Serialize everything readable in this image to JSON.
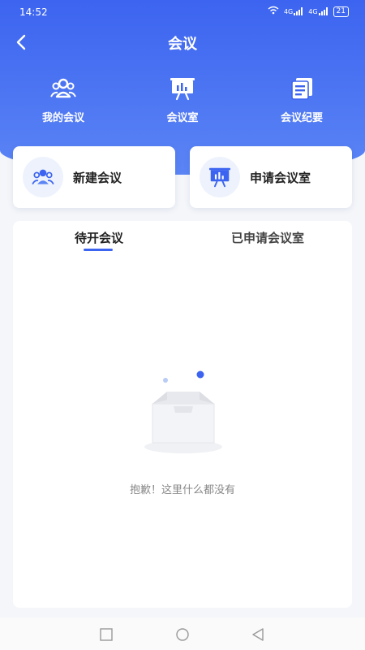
{
  "status": {
    "time": "14:52",
    "signal1": "4G",
    "signal2": "4G",
    "battery": "21"
  },
  "header": {
    "title": "会议"
  },
  "quick_nav": [
    {
      "label": "我的会议",
      "icon": "group-icon"
    },
    {
      "label": "会议室",
      "icon": "presentation-board-icon"
    },
    {
      "label": "会议纪要",
      "icon": "notes-icon"
    }
  ],
  "actions": [
    {
      "label": "新建会议",
      "icon": "group-icon"
    },
    {
      "label": "申请会议室",
      "icon": "presentation-board-icon"
    }
  ],
  "tabs": [
    {
      "label": "待开会议",
      "active": true
    },
    {
      "label": "已申请会议室",
      "active": false
    }
  ],
  "empty": {
    "message": "抱歉！这里什么都没有"
  },
  "colors": {
    "primary": "#3c64f0",
    "background": "#f4f6fa"
  }
}
